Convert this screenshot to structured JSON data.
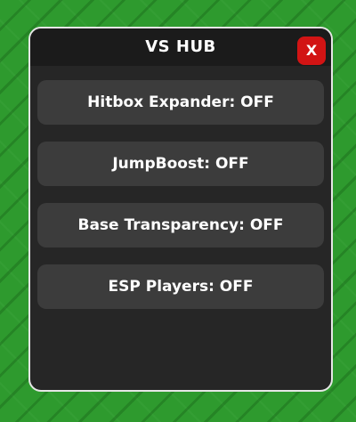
{
  "window": {
    "title": "VS HUB",
    "close_label": "X"
  },
  "buttons": [
    {
      "label": "Hitbox Expander: OFF"
    },
    {
      "label": "JumpBoost: OFF"
    },
    {
      "label": "Base Transparency: OFF"
    },
    {
      "label": "ESP Players: OFF"
    }
  ],
  "colors": {
    "background_grass": "#2e9a2e",
    "window_bg": "#262626",
    "titlebar_bg": "#1b1b1b",
    "button_bg": "#3c3c3c",
    "close_button_bg": "#d21414",
    "text": "#ffffff"
  }
}
